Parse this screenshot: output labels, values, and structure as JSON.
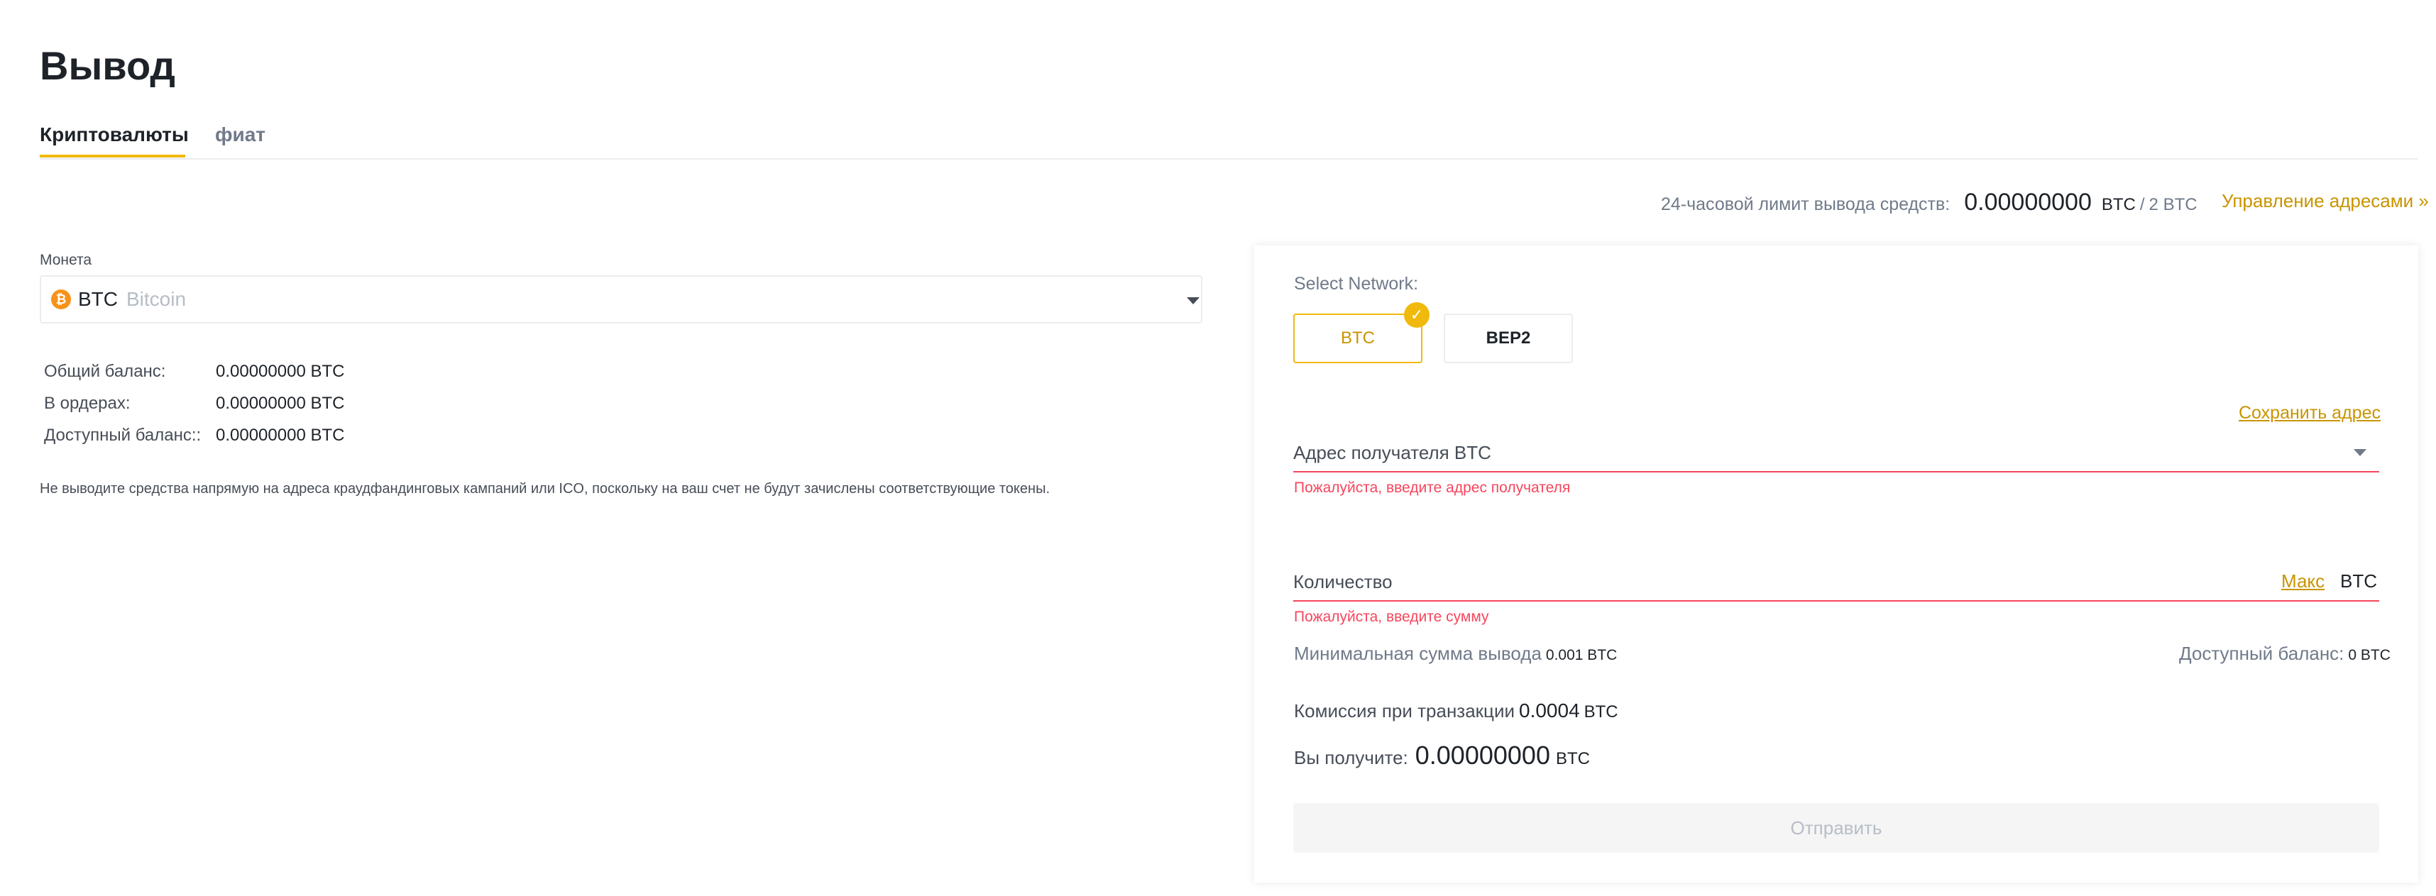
{
  "page": {
    "title": "Вывод"
  },
  "tabs": [
    {
      "label": "Криптовалюты",
      "active": true
    },
    {
      "label": "фиат",
      "active": false
    }
  ],
  "limit": {
    "label": "24-часовой лимит вывода средств:",
    "value": "0.00000000",
    "unit": "BTC",
    "separator": "/",
    "total": "2 BTC",
    "manage_link": "Управление адресами »"
  },
  "coin": {
    "label": "Монета",
    "symbol": "BTC",
    "name": "Bitcoin",
    "icon": "bitcoin-icon",
    "icon_glyph": "₿",
    "icon_color": "#f7931a"
  },
  "balances": [
    {
      "label": "Общий баланс:",
      "value": "0.00000000 BTC"
    },
    {
      "label": "В ордерах:",
      "value": "0.00000000 BTC"
    },
    {
      "label": "Доступный баланс::",
      "value": "0.00000000 BTC"
    }
  ],
  "warning": "Не выводите средства напрямую на адреса краудфандинговых кампаний или ICO, поскольку на ваш счет не будут зачислены соответствующие токены.",
  "network": {
    "label": "Select Network:",
    "options": [
      {
        "label": "BTC",
        "selected": true
      },
      {
        "label": "BEP2",
        "selected": false
      }
    ]
  },
  "address": {
    "save_link": "Сохранить адрес",
    "placeholder": "Адрес получателя BTC",
    "value": "",
    "error": "Пожалуйста, введите адрес получателя"
  },
  "amount": {
    "placeholder": "Количество",
    "value": "",
    "max_label": "Макс",
    "unit": "BTC",
    "error": "Пожалуйста, введите сумму"
  },
  "min_withdraw": {
    "label": "Минимальная сумма вывода",
    "value": "0.001 BTC"
  },
  "available": {
    "label": "Доступный баланс:",
    "value": "0 BTC"
  },
  "fee": {
    "label": "Комиссия при транзакции",
    "value": "0.0004",
    "unit": "BTC"
  },
  "receive": {
    "label": "Вы получите:",
    "value": "0.00000000",
    "unit": "BTC"
  },
  "submit": {
    "label": "Отправить",
    "enabled": false
  },
  "colors": {
    "accent": "#f0b90b",
    "accent_text": "#c99400",
    "error": "#f6465d"
  }
}
